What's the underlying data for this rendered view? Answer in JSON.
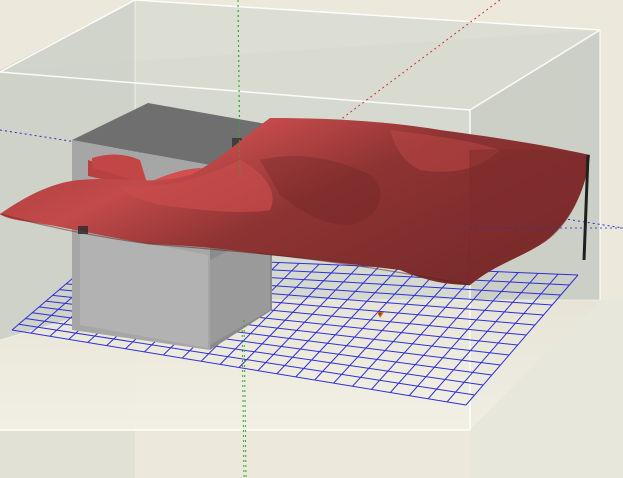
{
  "scene": {
    "kind": "3d-simulation-viewport",
    "colors": {
      "background": "#ece9dc",
      "container_walls": "#cfd2c8",
      "container_edges": "#ffffff",
      "obstacle_block": "#9a9a9a",
      "cloth_surface": "#a53b3b",
      "cloth_highlight": "#c95050",
      "cloth_shadow": "#6e2a2a",
      "grid_lines": "#2f2fd8",
      "axis_x_red": "#d43030",
      "axis_y_green": "#2ea82e",
      "axis_z_blue": "#2b2bcc",
      "origin_marker": "#d07020"
    },
    "objects": [
      "container-box",
      "obstacle-block",
      "cloth-sheet",
      "floor-grid",
      "coordinate-axes",
      "origin-marker"
    ]
  }
}
